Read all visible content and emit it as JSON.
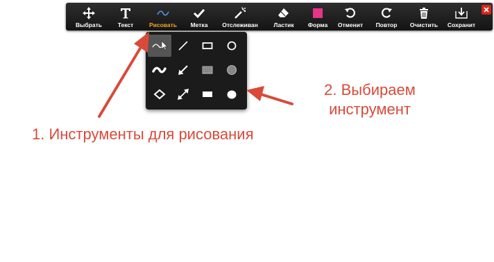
{
  "toolbar": {
    "tools": [
      {
        "label": "Выбрать",
        "icon": "move-icon"
      },
      {
        "label": "Текст",
        "icon": "text-icon"
      },
      {
        "label": "Рисовать",
        "icon": "draw-icon",
        "active": true
      },
      {
        "label": "Метка",
        "icon": "checkmark-icon"
      },
      {
        "label": "Отслеживан",
        "icon": "spotlight-icon"
      },
      {
        "label": "Ластик",
        "icon": "eraser-icon"
      },
      {
        "label": "Форма",
        "icon": "color-square-icon"
      },
      {
        "label": "Отменит",
        "icon": "undo-icon"
      },
      {
        "label": "Повтор",
        "icon": "redo-icon"
      },
      {
        "label": "Очистить",
        "icon": "trash-icon"
      },
      {
        "label": "Сохранит",
        "icon": "save-icon"
      }
    ],
    "close_icon": "close-icon"
  },
  "palette": {
    "rows": [
      [
        "squiggle-thin-icon",
        "line-icon",
        "rectangle-outline-icon",
        "ellipse-outline-icon"
      ],
      [
        "squiggle-thick-icon",
        "arrow-icon",
        "rectangle-hatched-icon",
        "ellipse-hatched-icon"
      ],
      [
        "diamond-outline-icon",
        "double-arrow-icon",
        "rectangle-filled-icon",
        "ellipse-filled-icon"
      ]
    ],
    "selected": "squiggle-thin-icon"
  },
  "annotations": {
    "step1": "1. Инструменты для рисования",
    "step2_line1": "2. Выбираем",
    "step2_line2": "инструмент"
  },
  "colors": {
    "accent_active": "#f5a623",
    "shape_color": "#e8338a",
    "annotation": "#d94a3a",
    "close": "#d9261c"
  }
}
